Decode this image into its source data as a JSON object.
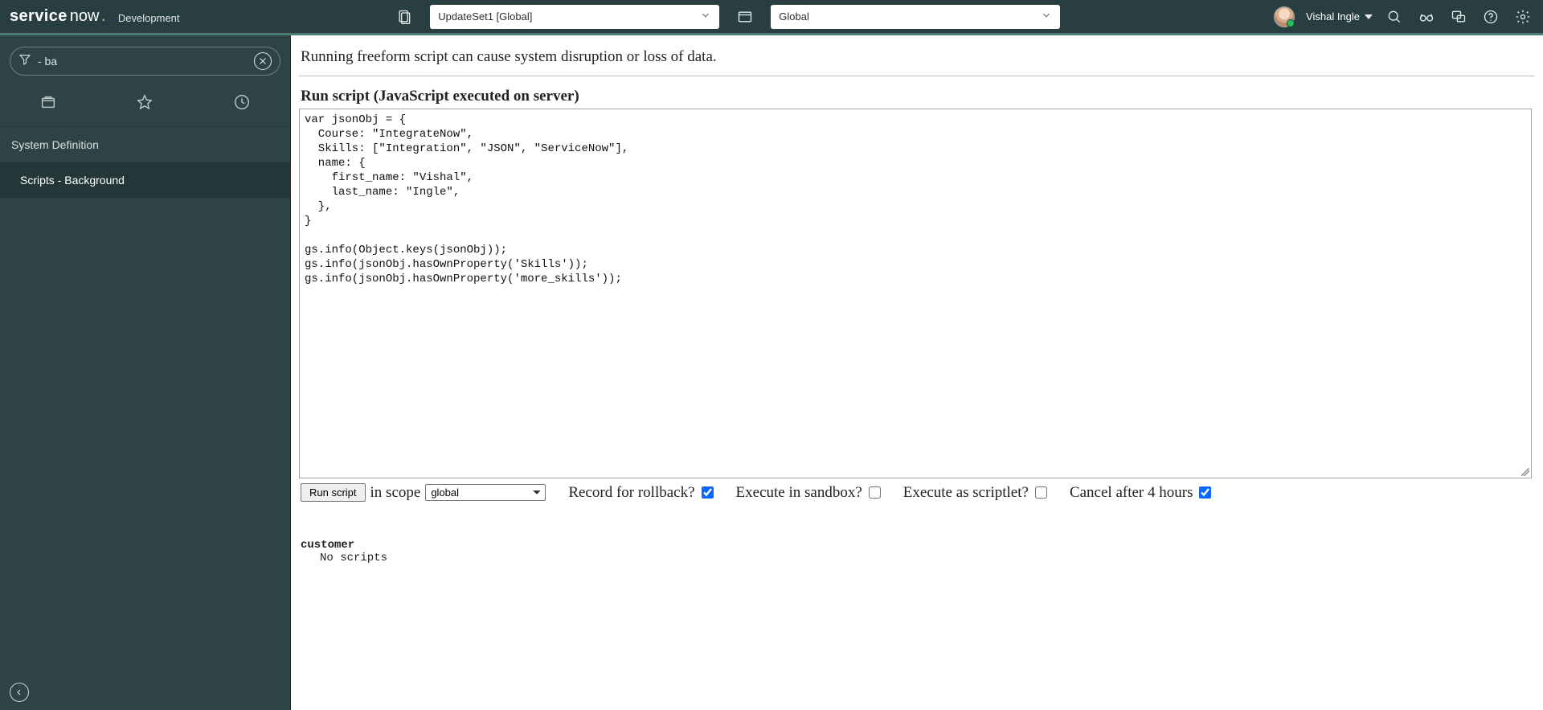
{
  "header": {
    "logo_service": "service",
    "logo_now": "now",
    "env": "Development",
    "update_set": "UpdateSet1 [Global]",
    "app_scope": "Global",
    "user_name": "Vishal Ingle"
  },
  "sidebar": {
    "filter_value": "- ba",
    "module": "System Definition",
    "item": "Scripts - Background"
  },
  "main": {
    "warning": "Running freeform script can cause system disruption or loss of data.",
    "heading": "Run script (JavaScript executed on server)",
    "script": "var jsonObj = {\n  Course: \"IntegrateNow\",\n  Skills: [\"Integration\", \"JSON\", \"ServiceNow\"],\n  name: {\n    first_name: \"Vishal\",\n    last_name: \"Ingle\",\n  },\n}\n\ngs.info(Object.keys(jsonObj));\ngs.info(jsonObj.hasOwnProperty('Skills'));\ngs.info(jsonObj.hasOwnProperty('more_skills'));",
    "controls": {
      "run_label": "Run script",
      "in_scope_label": "in scope",
      "scope_value": "global",
      "rollback_label": "Record for rollback?",
      "rollback_checked": true,
      "sandbox_label": "Execute in sandbox?",
      "sandbox_checked": false,
      "scriptlet_label": "Execute as scriptlet?",
      "scriptlet_checked": false,
      "cancel_label": "Cancel after 4 hours",
      "cancel_checked": true
    },
    "output": {
      "heading": "customer",
      "line": "No scripts"
    }
  }
}
